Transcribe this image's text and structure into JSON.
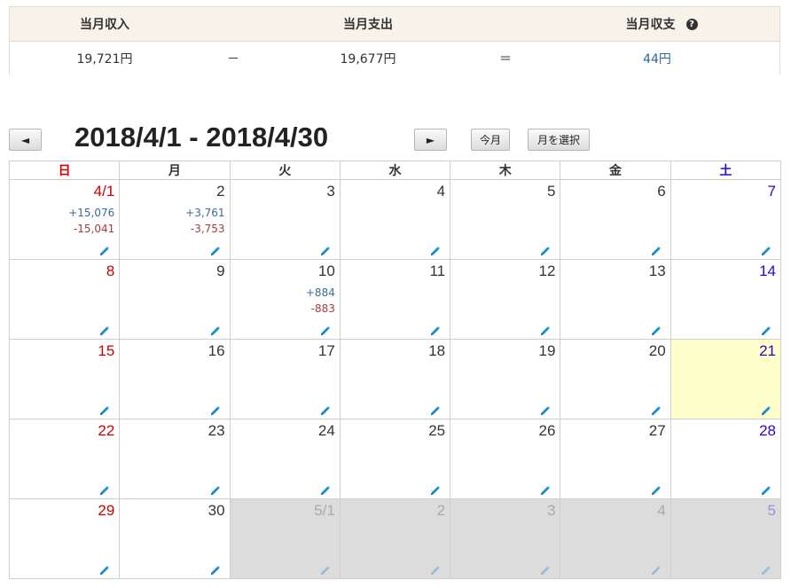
{
  "summary": {
    "income_label": "当月収入",
    "expense_label": "当月支出",
    "balance_label": "当月収支",
    "help_glyph": "?",
    "income_value": "19,721円",
    "minus_sign": "－",
    "expense_value": "19,677円",
    "equals_sign": "＝",
    "balance_value": "44円"
  },
  "nav": {
    "prev_label": "◄",
    "range_title": "2018/4/1 - 2018/4/30",
    "next_label": "►",
    "this_month_label": "今月",
    "select_month_label": "月を選択"
  },
  "calendar": {
    "weekdays": [
      "日",
      "月",
      "火",
      "水",
      "木",
      "金",
      "土"
    ],
    "weeks": [
      [
        {
          "label": "4/1",
          "income": "+15,076",
          "expense": "-15,041"
        },
        {
          "label": "2",
          "income": "+3,761",
          "expense": "-3,753"
        },
        {
          "label": "3"
        },
        {
          "label": "4"
        },
        {
          "label": "5"
        },
        {
          "label": "6"
        },
        {
          "label": "7"
        }
      ],
      [
        {
          "label": "8"
        },
        {
          "label": "9"
        },
        {
          "label": "10",
          "income": "+884",
          "expense": "-883"
        },
        {
          "label": "11"
        },
        {
          "label": "12"
        },
        {
          "label": "13"
        },
        {
          "label": "14"
        }
      ],
      [
        {
          "label": "15"
        },
        {
          "label": "16"
        },
        {
          "label": "17"
        },
        {
          "label": "18"
        },
        {
          "label": "19"
        },
        {
          "label": "20"
        },
        {
          "label": "21",
          "today": true
        }
      ],
      [
        {
          "label": "22"
        },
        {
          "label": "23"
        },
        {
          "label": "24"
        },
        {
          "label": "25"
        },
        {
          "label": "26"
        },
        {
          "label": "27"
        },
        {
          "label": "28"
        }
      ],
      [
        {
          "label": "29"
        },
        {
          "label": "30"
        },
        {
          "label": "5/1",
          "other": true
        },
        {
          "label": "2",
          "other": true
        },
        {
          "label": "3",
          "other": true
        },
        {
          "label": "4",
          "other": true
        },
        {
          "label": "5",
          "other": true
        }
      ]
    ]
  },
  "colors": {
    "sunday": "#d00000",
    "saturday": "#3300cc",
    "income": "#3d6a99",
    "expense": "#a63b3b",
    "today_bg": "#ffffcc",
    "other_month_bg": "#dcdcdc",
    "pencil": "#1a8fd0"
  },
  "icons": {
    "edit": "pencil-icon",
    "help": "question-circle-icon"
  }
}
